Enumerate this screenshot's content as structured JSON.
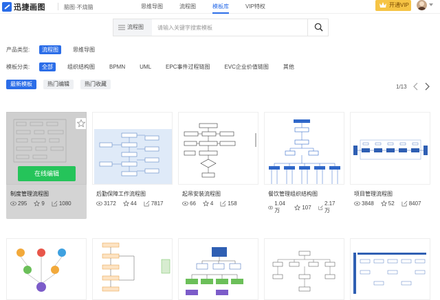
{
  "header": {
    "logo_text": "迅捷画图",
    "subtitle": "脑图·不烧脑",
    "nav": [
      "思维导图",
      "流程图",
      "模板库",
      "VIP特权"
    ],
    "active_nav": 2,
    "vip_button": "开通VIP"
  },
  "search": {
    "type_label": "流程图",
    "placeholder": "请输入关键字搜索模板",
    "value": ""
  },
  "filters": {
    "product_label": "产品类型:",
    "product_options": [
      "流程图",
      "思维导图"
    ],
    "product_active": 0,
    "category_label": "模板分类:",
    "category_options": [
      "全部",
      "组织结构图",
      "BPMN",
      "UML",
      "EPC事件过程链图",
      "EVC企业价值链图",
      "其他"
    ],
    "category_active": 0
  },
  "sort": {
    "options": [
      "最新模板",
      "热门编辑",
      "热门收藏"
    ],
    "active": 0
  },
  "pagination": {
    "current": 1,
    "total": 13,
    "text": "1/13"
  },
  "cards": [
    {
      "title": "制度管理流程图",
      "views": "295",
      "likes": "9",
      "edits": "1080",
      "hover_button": "在线编辑"
    },
    {
      "title": "后勤保障工作流程图",
      "views": "3172",
      "likes": "44",
      "edits": "7817"
    },
    {
      "title": "起吊安装流程图",
      "views": "66",
      "likes": "4",
      "edits": "158"
    },
    {
      "title": "餐饮管理组织结构图",
      "views": "1.04万",
      "likes": "107",
      "edits": "2.17万"
    },
    {
      "title": "项目管理流程图",
      "views": "3848",
      "likes": "52",
      "edits": "8407"
    }
  ],
  "colors": {
    "accent": "#2b6de8",
    "green": "#25c45a",
    "vip": "#f6c445"
  },
  "icons": [
    "logo-icon",
    "crown-icon",
    "search-icon",
    "chevron-left-icon",
    "chevron-right-icon",
    "eye-icon",
    "star-icon",
    "edit-icon",
    "favorite-star-icon"
  ]
}
